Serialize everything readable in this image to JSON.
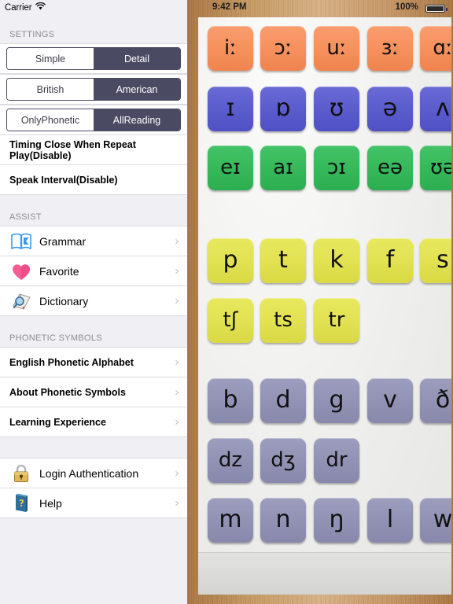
{
  "sidebar": {
    "status": {
      "carrier": "Carrier",
      "wifi_icon": "wifi-icon"
    },
    "settings_header": "SETTINGS",
    "segments": [
      {
        "name": "display-mode",
        "left": "Simple",
        "right": "Detail",
        "selected": "Detail"
      },
      {
        "name": "accent",
        "left": "British",
        "right": "American",
        "selected": "American"
      },
      {
        "name": "reading-mode",
        "left": "OnlyPhonetic",
        "right": "AllReading",
        "selected": "AllReading"
      }
    ],
    "setting_rows": [
      {
        "label": "Timing Close When Repeat Play(Disable)"
      },
      {
        "label": "Speak Interval(Disable)"
      }
    ],
    "assist_header": "ASSIST",
    "assist_rows": [
      {
        "label": "Grammar",
        "icon": "book-icon"
      },
      {
        "label": "Favorite",
        "icon": "heart-icon"
      },
      {
        "label": "Dictionary",
        "icon": "dictionary-icon"
      }
    ],
    "phonetic_header": "PHONETIC SYMBOLS",
    "phonetic_rows": [
      {
        "label": "English Phonetic Alphabet"
      },
      {
        "label": "About Phonetic Symbols"
      },
      {
        "label": "Learning Experience"
      }
    ],
    "account_rows": [
      {
        "label": "Login Authentication",
        "icon": "lock-icon"
      },
      {
        "label": "Help",
        "icon": "help-book-icon"
      }
    ],
    "chevron": "›"
  },
  "detail": {
    "status": {
      "time": "9:42 PM",
      "battery_percent": "100%",
      "battery_icon": "battery-full-icon"
    },
    "rows": [
      {
        "group": "long-vowels",
        "color": "#f6915d",
        "class": "c-orange",
        "symbols": [
          "iː",
          "ɔː",
          "uː",
          "ɜː",
          "ɑː"
        ]
      },
      {
        "group": "short-vowels",
        "color": "#5b5ccd",
        "class": "c-blue",
        "symbols": [
          "ɪ",
          "ɒ",
          "ʊ",
          "ə",
          "ʌ"
        ]
      },
      {
        "group": "diphthongs",
        "color": "#36b95b",
        "class": "c-green",
        "symbols": [
          "eɪ",
          "aɪ",
          "ɔɪ",
          "eə",
          "ʊə"
        ]
      },
      {
        "group": "voiceless-1",
        "color": "#e2e253",
        "class": "c-yellow",
        "symbols": [
          "p",
          "t",
          "k",
          "f",
          "s"
        ]
      },
      {
        "group": "voiceless-2",
        "color": "#e2e253",
        "class": "c-yellow",
        "symbols": [
          "tʃ",
          "ts",
          "tr"
        ]
      },
      {
        "group": "voiced-1",
        "color": "#9292b5",
        "class": "c-mauve",
        "symbols": [
          "b",
          "d",
          "g",
          "v",
          "ð"
        ]
      },
      {
        "group": "voiced-2",
        "color": "#9292b5",
        "class": "c-mauve",
        "symbols": [
          "dz",
          "dʒ",
          "dr"
        ]
      },
      {
        "group": "nasals-glides",
        "color": "#9292b5",
        "class": "c-mauve",
        "symbols": [
          "m",
          "n",
          "ŋ",
          "l",
          "w"
        ]
      }
    ]
  }
}
